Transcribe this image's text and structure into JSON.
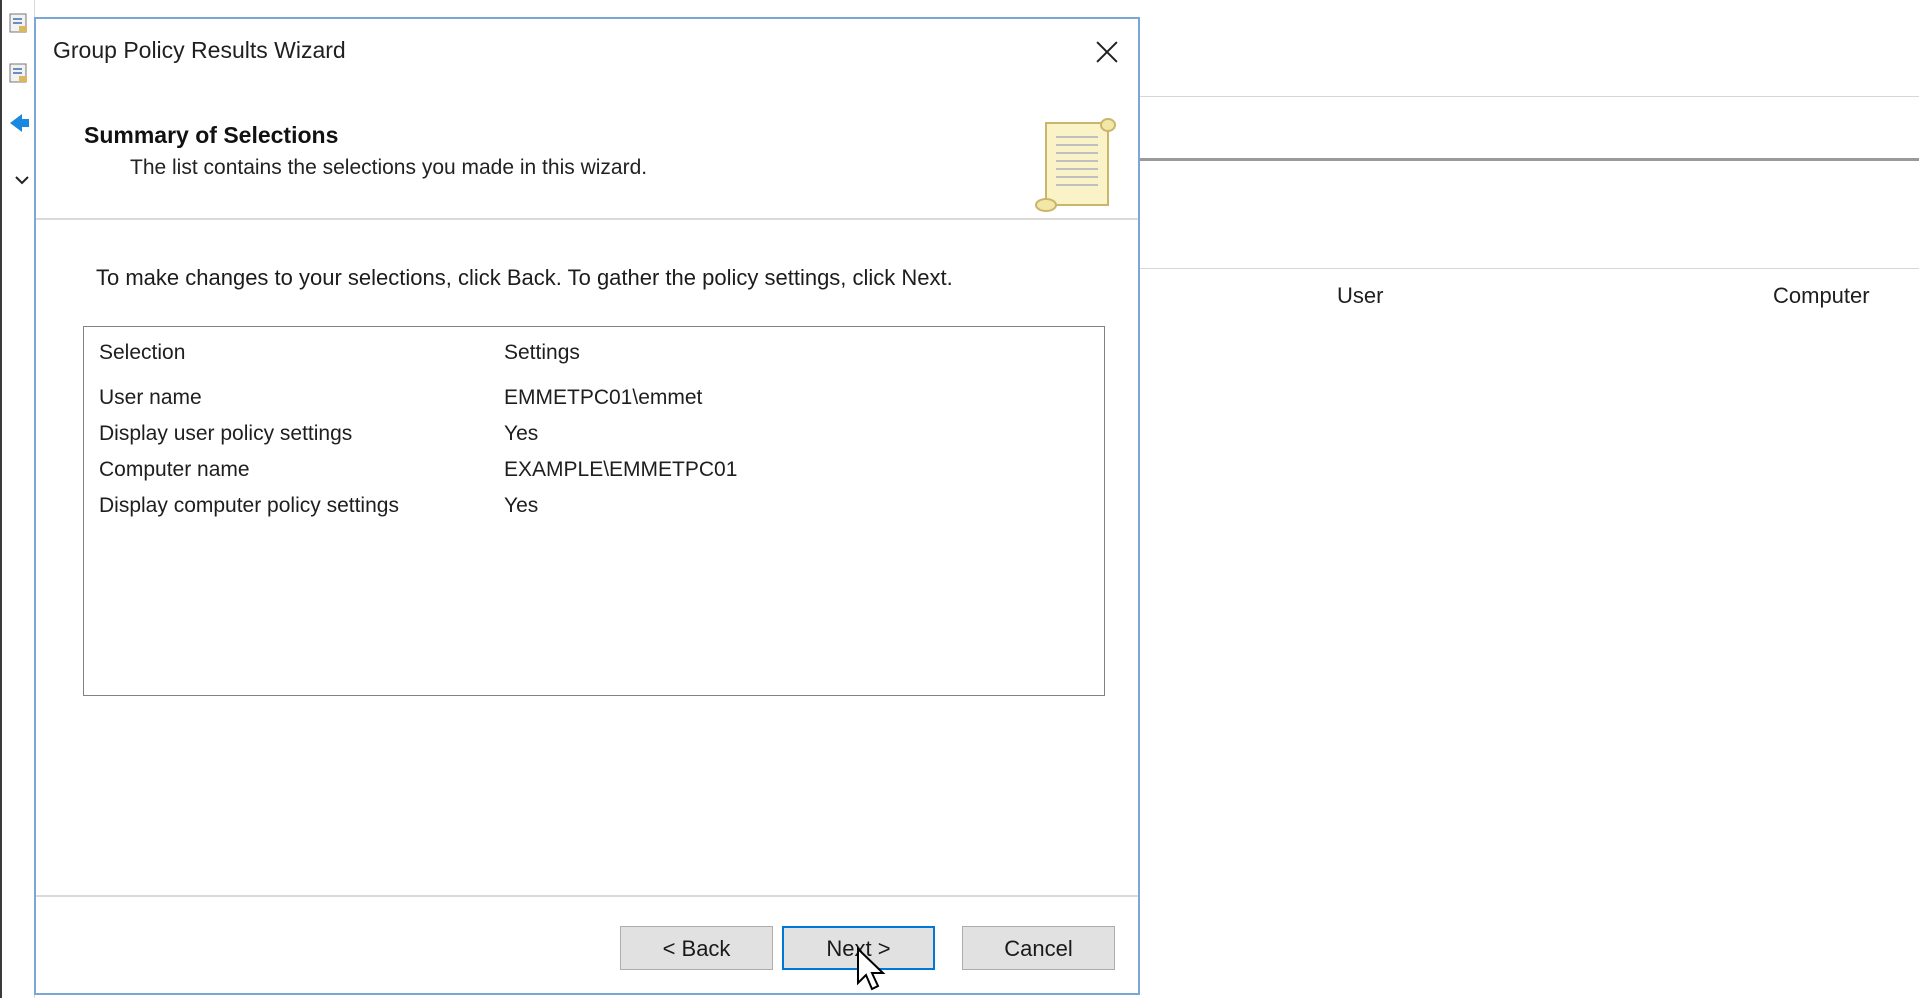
{
  "dialog": {
    "title": "Group Policy Results Wizard",
    "heading": "Summary of Selections",
    "subheading": "The list contains the selections you made in this wizard.",
    "instruction": "To make changes to your selections, click Back. To gather the policy settings, click Next.",
    "list_headers": {
      "selection": "Selection",
      "settings": "Settings"
    },
    "rows": [
      {
        "selection": "User name",
        "settings": "EMMETPC01\\emmet"
      },
      {
        "selection": "Display user policy settings",
        "settings": "Yes"
      },
      {
        "selection": "Computer name",
        "settings": "EXAMPLE\\EMMETPC01"
      },
      {
        "selection": "Display computer policy settings",
        "settings": "Yes"
      }
    ],
    "buttons": {
      "back": "< Back",
      "next": "Next >",
      "cancel": "Cancel"
    },
    "icons": {
      "close": "close-icon",
      "header": "scroll-icon"
    }
  },
  "background": {
    "column_headers": [
      "User",
      "Computer"
    ],
    "icons": [
      "policy-icon",
      "policy-icon",
      "back-arrow-icon",
      "chevron-down-icon"
    ]
  },
  "colors": {
    "dialog_border": "#7aa7d8",
    "default_button_border": "#0078d7",
    "button_face": "#e1e1e1",
    "back_arrow": "#1a88e0"
  }
}
